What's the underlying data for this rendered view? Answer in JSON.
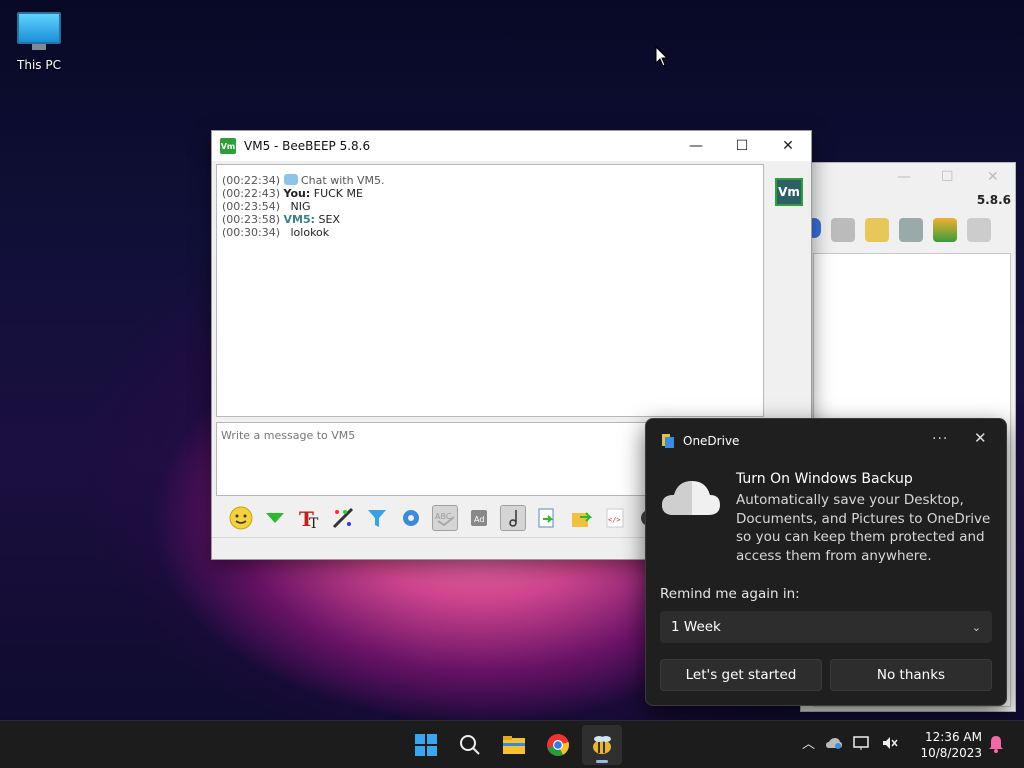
{
  "desktop": {
    "icon_label": "This PC"
  },
  "window": {
    "title": "VM5 - BeeBEEP 5.8.6",
    "logo_text": "Vm",
    "avatar_text": "Vm",
    "input_placeholder": "Write a message to VM5"
  },
  "chat": {
    "messages": [
      {
        "time": "(00:22:34)",
        "sender": "",
        "text": "Chat with VM5."
      },
      {
        "time": "(00:22:43)",
        "sender": "You:",
        "text": "FUCK ME"
      },
      {
        "time": "(00:23:54)",
        "sender": "",
        "text": "NIG"
      },
      {
        "time": "(00:23:58)",
        "sender": "VM5:",
        "text": "SEX"
      },
      {
        "time": "(00:30:34)",
        "sender": "",
        "text": "lolokok"
      }
    ]
  },
  "back_window": {
    "version": "5.8.6"
  },
  "toast": {
    "app_name": "OneDrive",
    "title": "Turn On Windows Backup",
    "body": "Automatically save your Desktop, Documents, and Pictures to OneDrive so you can keep them protected and access them from anywhere.",
    "remind_label": "Remind me again in:",
    "remind_value": "1 Week",
    "primary_button": "Let's get started",
    "secondary_button": "No thanks",
    "more_glyph": "···",
    "close_glyph": "✕"
  },
  "taskbar": {
    "time": "12:36 AM",
    "date": "10/8/2023"
  },
  "colors": {
    "accent_green": "#2e9e3a",
    "vm_teal": "#3b8088",
    "toast_bg": "#1f1f1f",
    "taskbar_bg": "#1c1c1c"
  }
}
